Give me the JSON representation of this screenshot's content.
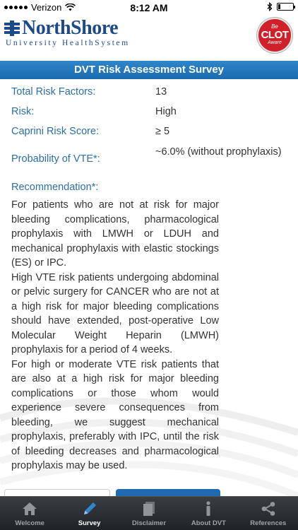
{
  "status_bar": {
    "carrier": "Verizon",
    "time": "8:12 AM",
    "battery_level": 0.15
  },
  "header": {
    "logo_name": "NorthShore",
    "logo_subtitle": "University HealthSystem",
    "badge_line1": "Be",
    "badge_line2": "CLOT",
    "badge_line3": "Aware"
  },
  "title": "DVT Risk Assessment Survey",
  "results": [
    {
      "label": "Total Risk Factors:",
      "value": "13"
    },
    {
      "label": "Risk:",
      "value": "High"
    },
    {
      "label": "Caprini Risk Score:",
      "value": "≥ 5"
    },
    {
      "label": "Probability of VTE*:",
      "value": "~6.0% (without prophylaxis)"
    }
  ],
  "recommendation": {
    "label": "Recommendation*:",
    "paragraphs": [
      "For patients who are not at risk for major bleeding complications, pharmacological prophylaxis with LMWH or LDUH and mechanical prophylaxis with elastic stockings (ES) or IPC.",
      "High VTE risk patients undergoing abdominal or pelvic surgery for CANCER who are not at a high risk for major bleeding complications should have extended, post-operative Low Molecular Weight Heparin (LMWH) prophylaxis for a period of 4 weeks.",
      "For high or moderate VTE risk patients that are also at a high risk for major bleeding complications or those whom would experience severe consequences from bleeding, we suggest mechanical prophylaxis, preferably with IPC, until the risk of bleeding decreases and pharmacological prophylaxis may be used."
    ]
  },
  "tabs": [
    {
      "label": "Welcome",
      "icon": "home-icon"
    },
    {
      "label": "Survey",
      "icon": "pencil-icon",
      "active": true
    },
    {
      "label": "Disclaimer",
      "icon": "document-icon"
    },
    {
      "label": "About DVT",
      "icon": "info-icon"
    },
    {
      "label": "References",
      "icon": "share-icon"
    }
  ],
  "colors": {
    "title_bar": "#1f75bb",
    "label_blue": "#2b6fa8",
    "logo_blue": "#1e4a8a",
    "badge_red": "#d0202a",
    "tab_bar": "#2b2e33"
  }
}
